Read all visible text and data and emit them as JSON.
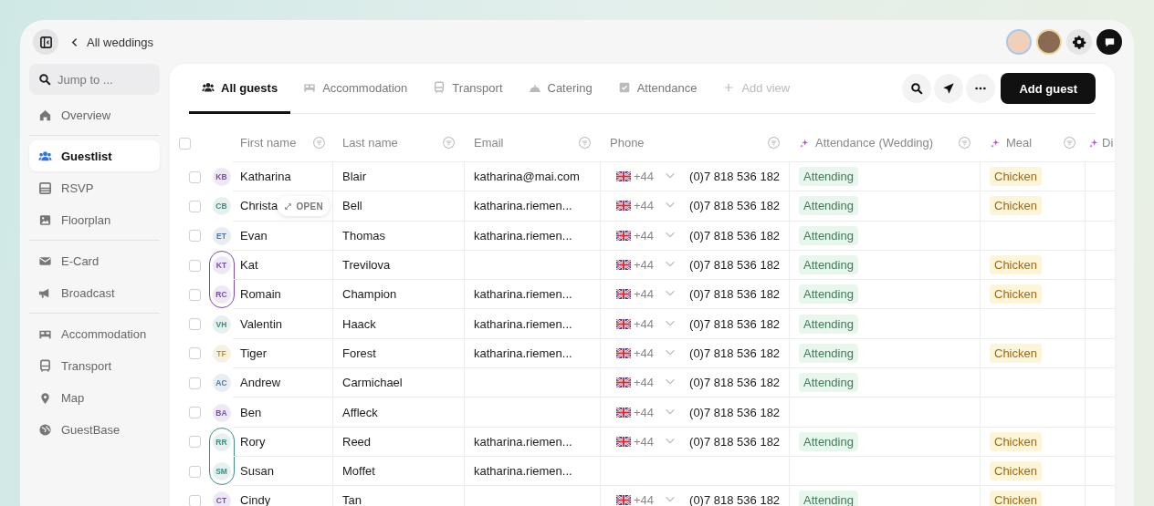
{
  "topbar": {
    "back_link": "All weddings"
  },
  "sidebar": {
    "search": {
      "placeholder": "Jump to ..."
    },
    "groups": [
      [
        {
          "label": "Overview",
          "selected": false
        }
      ],
      [
        {
          "label": "Guestlist",
          "selected": true
        },
        {
          "label": "RSVP",
          "selected": false
        },
        {
          "label": "Floorplan",
          "selected": false
        }
      ],
      [
        {
          "label": "E-Card",
          "selected": false
        },
        {
          "label": "Broadcast",
          "selected": false
        }
      ],
      [
        {
          "label": "Accommodation",
          "selected": false
        },
        {
          "label": "Transport",
          "selected": false
        },
        {
          "label": "Map",
          "selected": false
        },
        {
          "label": "GuestBase",
          "selected": false
        }
      ]
    ]
  },
  "tabs": [
    {
      "label": "All guests",
      "kind": "view",
      "selected": true
    },
    {
      "label": "Accommodation",
      "kind": "view",
      "selected": false
    },
    {
      "label": "Transport",
      "kind": "view",
      "selected": false
    },
    {
      "label": "Catering",
      "kind": "view",
      "selected": false
    },
    {
      "label": "Attendance",
      "kind": "view",
      "selected": false
    },
    {
      "label": "Add view",
      "kind": "add",
      "selected": false
    }
  ],
  "toolbar": {
    "add_button": "Add guest"
  },
  "table": {
    "select_all_checked": false,
    "columns": [
      {
        "label": "First name",
        "ai": false,
        "filter": true
      },
      {
        "label": "Last name",
        "ai": false,
        "filter": true
      },
      {
        "label": "Email",
        "ai": false,
        "filter": true
      },
      {
        "label": "Phone",
        "ai": false,
        "filter": true
      },
      {
        "label": "Attendance (Wedding)",
        "ai": true,
        "filter": true
      },
      {
        "label": "Meal",
        "ai": true,
        "filter": true
      },
      {
        "label": "Di",
        "ai": true,
        "filter": false
      }
    ],
    "rows": [
      {
        "checked": false,
        "initials": "KB",
        "color": "#7b4bb0",
        "first_name": "Katharina",
        "last_name": "Blair",
        "email": "katharina@mai.com",
        "phone": {
          "code": "+44",
          "number": "(0)7 818 536 182"
        },
        "attendance": "Attending",
        "meal": "Chicken",
        "linked_to_next": false
      },
      {
        "checked": false,
        "initials": "CB",
        "color": "#3a8f86",
        "first_name": "Christa",
        "open_button": "OPEN",
        "last_name": "Bell",
        "email": "katharina.riemen...",
        "phone": {
          "code": "+44",
          "number": "(0)7 818 536 182"
        },
        "attendance": "Attending",
        "meal": "Chicken",
        "linked_to_next": false
      },
      {
        "checked": false,
        "initials": "ET",
        "color": "#4f77a6",
        "first_name": "Evan",
        "last_name": "Thomas",
        "email": "katharina.riemen...",
        "phone": {
          "code": "+44",
          "number": "(0)7 818 536 182"
        },
        "attendance": "Attending",
        "linked_to_next": false
      },
      {
        "checked": false,
        "initials": "KT",
        "color": "#7b4bb0",
        "first_name": "Kat",
        "last_name": "Trevilova",
        "phone": {
          "code": "+44",
          "number": "(0)7 818 536 182"
        },
        "attendance": "Attending",
        "meal": "Chicken",
        "linked_to_next": true
      },
      {
        "checked": false,
        "initials": "RC",
        "color": "#7b4bb0",
        "first_name": "Romain",
        "last_name": "Champion",
        "email": "katharina.riemen...",
        "phone": {
          "code": "+44",
          "number": "(0)7 818 536 182"
        },
        "attendance": "Attending",
        "meal": "Chicken",
        "linked_to_next": false
      },
      {
        "checked": false,
        "initials": "VH",
        "color": "#3a8f86",
        "first_name": "Valentin",
        "last_name": "Haack",
        "email": "katharina.riemen...",
        "phone": {
          "code": "+44",
          "number": "(0)7 818 536 182"
        },
        "attendance": "Attending",
        "linked_to_next": false
      },
      {
        "checked": false,
        "initials": "TF",
        "color": "#b8962a",
        "first_name": "Tiger",
        "last_name": "Forest",
        "email": "katharina.riemen...",
        "phone": {
          "code": "+44",
          "number": "(0)7 818 536 182"
        },
        "attendance": "Attending",
        "meal": "Chicken",
        "linked_to_next": false
      },
      {
        "checked": false,
        "initials": "AC",
        "color": "#4f77a6",
        "first_name": "Andrew",
        "last_name": "Carmichael",
        "phone": {
          "code": "+44",
          "number": "(0)7 818 536 182"
        },
        "attendance": "Attending",
        "linked_to_next": false
      },
      {
        "checked": false,
        "initials": "BA",
        "color": "#7b4bb0",
        "first_name": "Ben",
        "last_name": "Affleck",
        "phone": {
          "code": "+44",
          "number": "(0)7 818 536 182"
        },
        "linked_to_next": false
      },
      {
        "checked": false,
        "initials": "RR",
        "color": "#3a8f86",
        "first_name": "Rory",
        "last_name": "Reed",
        "email": "katharina.riemen...",
        "phone": {
          "code": "+44",
          "number": "(0)7 818 536 182"
        },
        "attendance": "Attending",
        "meal": "Chicken",
        "linked_to_next": true
      },
      {
        "checked": false,
        "initials": "SM",
        "color": "#3a8f86",
        "first_name": "Susan",
        "last_name": "Moffet",
        "email": "katharina.riemen...",
        "meal": "Chicken",
        "linked_to_next": false
      },
      {
        "checked": false,
        "initials": "CT",
        "color": "#7b4bb0",
        "first_name": "Cindy",
        "last_name": "Tan",
        "phone": {
          "code": "+44",
          "number": "(0)7 818 536 182"
        },
        "attendance": "Attending",
        "meal": "Chicken",
        "linked_to_next": false
      }
    ]
  }
}
